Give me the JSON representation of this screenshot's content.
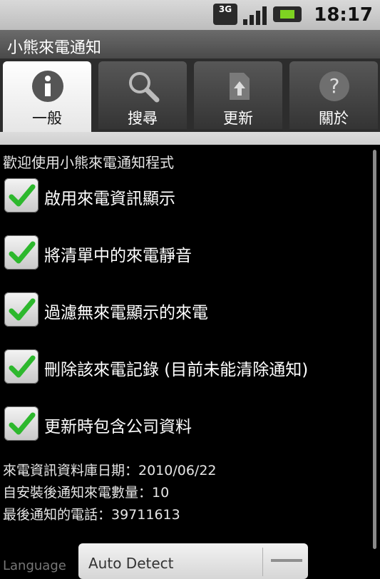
{
  "status_bar": {
    "network": "3G",
    "time": "18:17"
  },
  "app": {
    "title": "小熊來電通知"
  },
  "tabs": [
    {
      "label": "一般",
      "icon": "info-icon",
      "active": true
    },
    {
      "label": "搜尋",
      "icon": "search-icon",
      "active": false
    },
    {
      "label": "更新",
      "icon": "update-icon",
      "active": false
    },
    {
      "label": "關於",
      "icon": "help-icon",
      "active": false
    }
  ],
  "content": {
    "intro": "歡迎使用小熊來電通知程式",
    "checkboxes": [
      {
        "label": "啟用來電資訊顯示",
        "checked": true
      },
      {
        "label": "將清單中的來電靜音",
        "checked": true
      },
      {
        "label": "過濾無來電顯示的來電",
        "checked": true
      },
      {
        "label": "刪除該來電記錄 (目前未能清除通知)",
        "checked": true
      },
      {
        "label": "更新時包含公司資料",
        "checked": true
      }
    ],
    "info": {
      "db_date": "來電資訊資料庫日期：2010/06/22",
      "notify_count": "自安裝後通知來電數量：10",
      "last_phone": "最後通知的電話：39711613"
    },
    "language": {
      "label": "Language",
      "selected": "Auto Detect"
    }
  },
  "colors": {
    "check": "#2db82d",
    "accent": "#2d2d2d"
  }
}
